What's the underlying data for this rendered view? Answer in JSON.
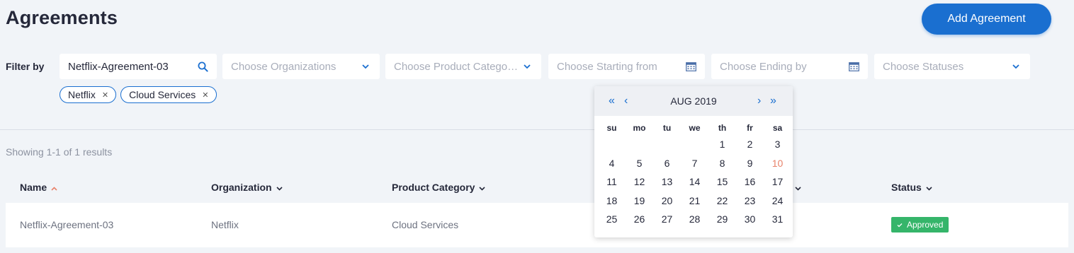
{
  "header": {
    "title": "Agreements",
    "add_button": "Add Agreement"
  },
  "filters": {
    "label": "Filter by",
    "search_value": "Netflix-Agreement-03",
    "organizations_placeholder": "Choose Organizations",
    "product_category_placeholder": "Choose Product Categori...",
    "starting_from_placeholder": "Choose Starting from",
    "ending_by_placeholder": "Choose Ending by",
    "statuses_placeholder": "Choose Statuses",
    "chips": [
      "Netflix",
      "Cloud Services"
    ]
  },
  "results": {
    "showing": "Showing 1-1 of 1 results"
  },
  "table": {
    "columns": [
      "Name",
      "Organization",
      "Product Category",
      "Status"
    ],
    "rows": [
      {
        "name": "Netflix-Agreement-03",
        "organization": "Netflix",
        "product_category": "Cloud Services",
        "status": "Approved"
      }
    ]
  },
  "calendar": {
    "month_label": "AUG 2019",
    "weekdays": [
      "su",
      "mo",
      "tu",
      "we",
      "th",
      "fr",
      "sa"
    ],
    "weeks": [
      [
        "",
        "",
        "",
        "",
        "1",
        "2",
        "3"
      ],
      [
        "4",
        "5",
        "6",
        "7",
        "8",
        "9",
        "10"
      ],
      [
        "11",
        "12",
        "13",
        "14",
        "15",
        "16",
        "17"
      ],
      [
        "18",
        "19",
        "20",
        "21",
        "22",
        "23",
        "24"
      ],
      [
        "25",
        "26",
        "27",
        "28",
        "29",
        "30",
        "31"
      ]
    ],
    "highlighted_day": "10"
  },
  "colors": {
    "accent": "#1a6fd0",
    "highlight": "#e8826a",
    "approved": "#35b56a"
  }
}
